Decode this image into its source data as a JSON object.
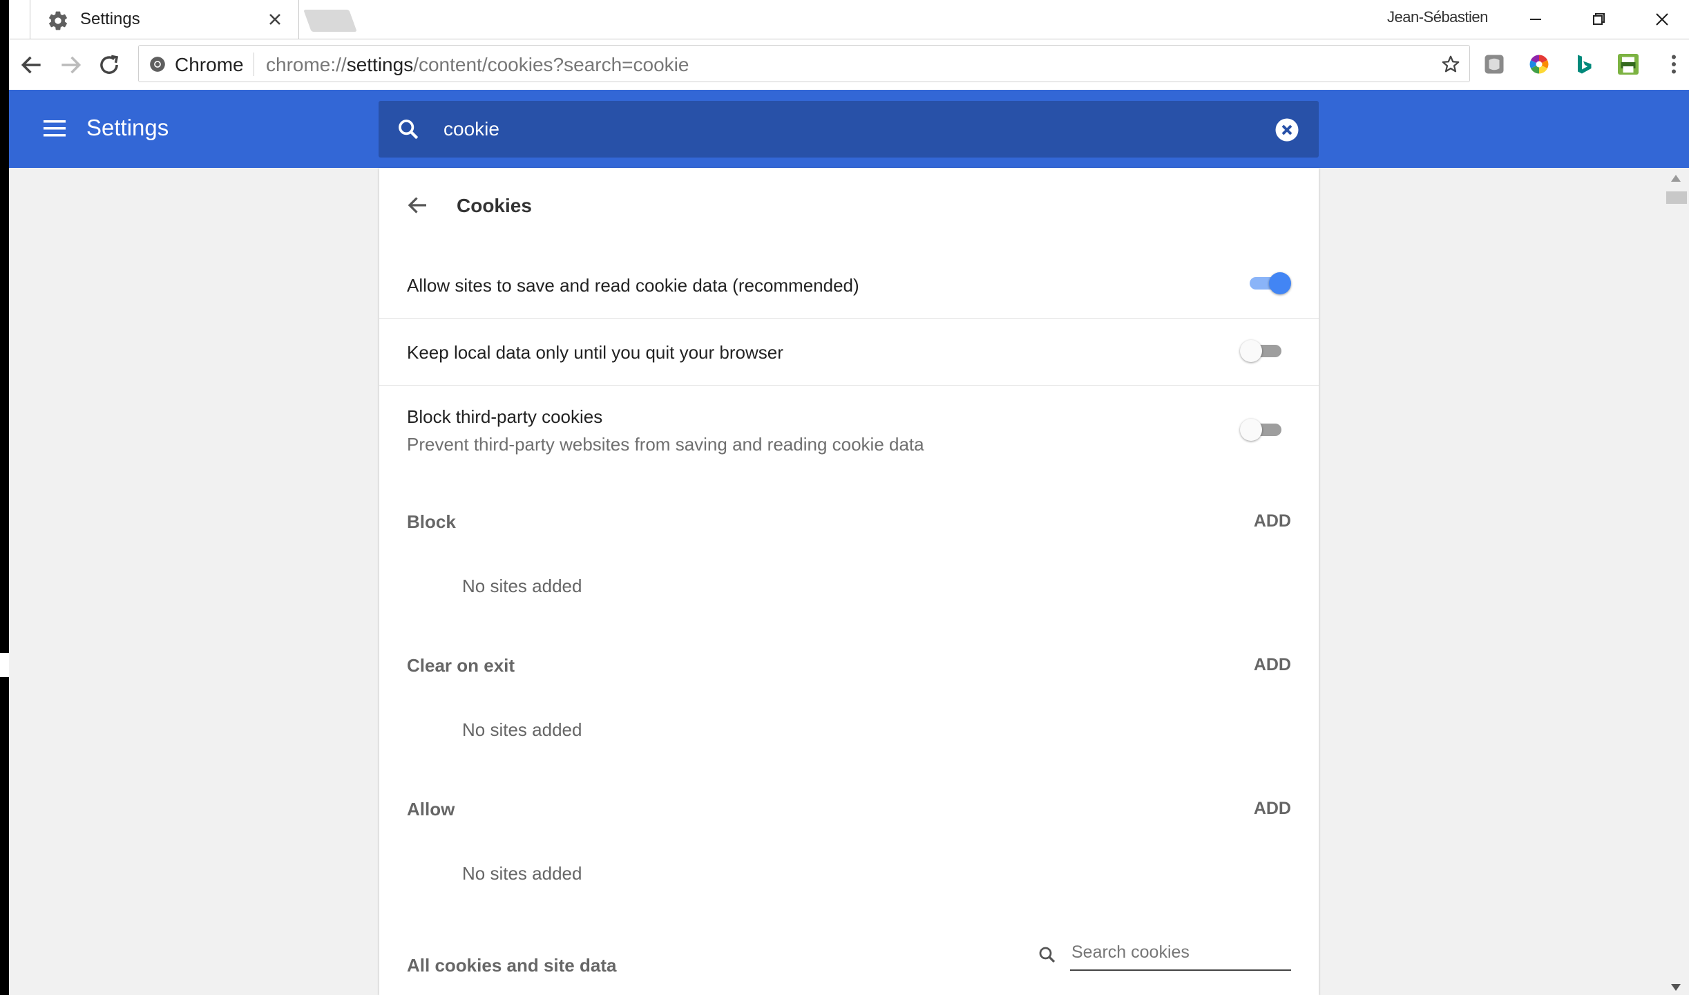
{
  "tab": {
    "title": "Settings",
    "close_label": "×"
  },
  "window": {
    "profile_name": "Jean-Sébastien"
  },
  "omnibox": {
    "secure_label": "Chrome",
    "url_scheme": "chrome://",
    "url_host": "settings",
    "url_path": "/content/cookies?search=cookie"
  },
  "header": {
    "title": "Settings",
    "search_value": "cookie"
  },
  "page": {
    "title": "Cookies",
    "allow_sites": {
      "label": "Allow sites to save and read cookie data (recommended)",
      "enabled": true
    },
    "keep_local": {
      "label": "Keep local data only until you quit your browser",
      "enabled": false
    },
    "block_third_party": {
      "label": "Block third-party cookies",
      "sublabel": "Prevent third-party websites from saving and reading cookie data",
      "enabled": false
    },
    "sections": [
      {
        "title": "Block",
        "add_label": "ADD",
        "empty_text": "No sites added"
      },
      {
        "title": "Clear on exit",
        "add_label": "ADD",
        "empty_text": "No sites added"
      },
      {
        "title": "Allow",
        "add_label": "ADD",
        "empty_text": "No sites added"
      }
    ],
    "all_cookies": {
      "title": "All cookies and site data",
      "search_placeholder": "Search cookies"
    }
  },
  "colors": {
    "header_blue": "#3367d6",
    "search_blue": "#2851a8",
    "toggle_on": "#4285f4"
  },
  "extensions": [
    "gray-extension-icon",
    "color-wheel-extension-icon",
    "bing-icon",
    "green-printer-extension-icon"
  ]
}
